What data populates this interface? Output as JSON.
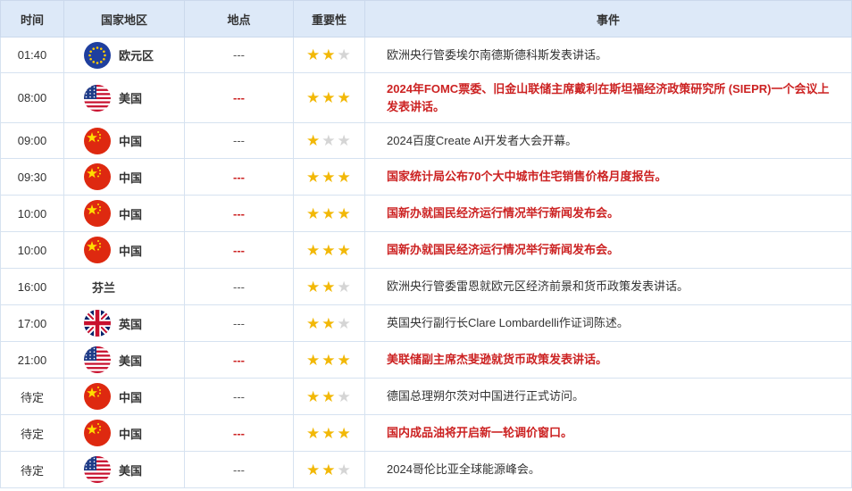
{
  "headers": {
    "time": "时间",
    "country": "国家地区",
    "location": "地点",
    "importance": "重要性",
    "event": "事件"
  },
  "colors": {
    "high": "#cc2222",
    "header_bg": "#dde9f8",
    "star": "#f2b807"
  },
  "rows": [
    {
      "time": "01:40",
      "flag": "eu-flag-icon",
      "country": "欧元区",
      "location": "---",
      "stars": 2,
      "event": "欧洲央行管委埃尔南德斯德科斯发表讲话。",
      "high": false
    },
    {
      "time": "08:00",
      "flag": "us-flag-icon",
      "country": "美国",
      "location": "---",
      "stars": 3,
      "event": "2024年FOMC票委、旧金山联储主席戴利在斯坦福经济政策研究所 (SIEPR)一个会议上发表讲话。",
      "high": true
    },
    {
      "time": "09:00",
      "flag": "cn-flag-icon",
      "country": "中国",
      "location": "---",
      "stars": 1,
      "event": "2024百度Create AI开发者大会开幕。",
      "high": false
    },
    {
      "time": "09:30",
      "flag": "cn-flag-icon",
      "country": "中国",
      "location": "---",
      "stars": 3,
      "event": "国家统计局公布70个大中城市住宅销售价格月度报告。",
      "high": true
    },
    {
      "time": "10:00",
      "flag": "cn-flag-icon",
      "country": "中国",
      "location": "---",
      "stars": 3,
      "event": "国新办就国民经济运行情况举行新闻发布会。",
      "high": true
    },
    {
      "time": "10:00",
      "flag": "cn-flag-icon",
      "country": "中国",
      "location": "---",
      "stars": 3,
      "event": "国新办就国民经济运行情况举行新闻发布会。",
      "high": true
    },
    {
      "time": "16:00",
      "flag": "",
      "country": "芬兰",
      "location": "---",
      "stars": 2,
      "event": "欧洲央行管委雷恩就欧元区经济前景和货币政策发表讲话。",
      "high": false
    },
    {
      "time": "17:00",
      "flag": "uk-flag-icon",
      "country": "英国",
      "location": "---",
      "stars": 2,
      "event": "英国央行副行长Clare Lombardelli作证词陈述。",
      "high": false
    },
    {
      "time": "21:00",
      "flag": "us-flag-icon",
      "country": "美国",
      "location": "---",
      "stars": 3,
      "event": "美联储副主席杰斐逊就货币政策发表讲话。",
      "high": true
    },
    {
      "time": "待定",
      "flag": "cn-flag-icon",
      "country": "中国",
      "location": "---",
      "stars": 2,
      "event": "德国总理朔尔茨对中国进行正式访问。",
      "high": false
    },
    {
      "time": "待定",
      "flag": "cn-flag-icon",
      "country": "中国",
      "location": "---",
      "stars": 3,
      "event": "国内成品油将开启新一轮调价窗口。",
      "high": true
    },
    {
      "time": "待定",
      "flag": "us-flag-icon",
      "country": "美国",
      "location": "---",
      "stars": 2,
      "event": "2024哥伦比亚全球能源峰会。",
      "high": false
    }
  ]
}
